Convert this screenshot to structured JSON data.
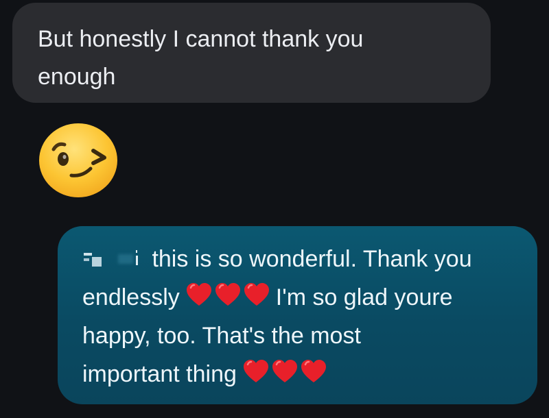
{
  "conversation": {
    "received_message": {
      "line1": "But honestly I cannot thank you",
      "line2": "enough"
    },
    "emoji_message": {
      "icon": "winking-face-emoji"
    },
    "sent_message": {
      "line1_text": " this is so wonderful. Thank you",
      "line2_text_a": "endlessly",
      "line2_text_b": "I'm so glad youre",
      "line3_text": "happy, too. That's the most",
      "line4_text": "important thing",
      "heart_icon": "red-heart-emoji",
      "heart_color": "#e8202a"
    }
  },
  "colors": {
    "background": "#101216",
    "received_bubble": "#2b2c30",
    "sent_bubble": "#0a4a62",
    "emoji_face": "#f8b92a"
  }
}
